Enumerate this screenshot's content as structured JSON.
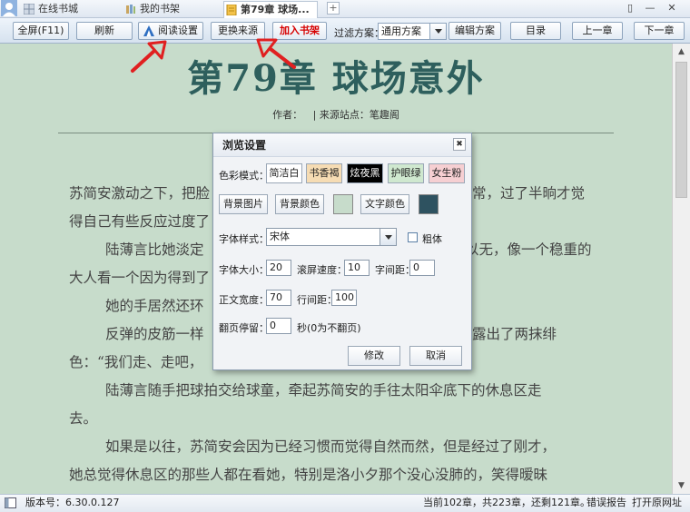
{
  "tabs": [
    {
      "label": "在线书城"
    },
    {
      "label": "我的书架"
    },
    {
      "label": "第79章 球场..."
    }
  ],
  "new_tab": "+",
  "window_controls": {
    "restore": "▯",
    "minimize": "—",
    "close": "✕"
  },
  "toolbar": {
    "fullscreen": "全屏(F11)",
    "refresh": "刷新",
    "read_settings": "阅读设置",
    "change_source": "更换来源",
    "add_shelf": "加入书架",
    "filter_label": "过滤方案：",
    "filter_value": "通用方案",
    "edit_filter": "编辑方案",
    "catalog": "目录",
    "prev": "上一章",
    "next": "下一章"
  },
  "chapter": {
    "title": "第79章  球场意外",
    "author_label": "作者：",
    "source_label": "| 来源站点：笔趣阁",
    "paragraphs": [
      "苏简安激动之下，把脸",
      "得自己有些反应过度了",
      "陆薄言比她淡定",
      "大人看一个因为得到了",
      "她的手居然还环",
      "反弹的皮筋一样",
      "色：“我们走、走吧，",
      "陆薄言随手把球拍交给球童，牵起苏简安的手往太阳伞底下的休息区走",
      "去。",
      "如果是以往，苏简安会因为已经习惯而觉得自然而然，但是经过了刚才，",
      "她总觉得休息区的那些人都在看她，特别是洛小夕那个没心没肺的，笑得暧昧"
    ],
    "right_fragments": [
      "常，过了半晌才觉",
      "以无，像一个稳重的",
      "露出了两抹绯"
    ]
  },
  "dialog": {
    "title": "浏览设置",
    "close": "✖",
    "color_mode_label": "色彩模式：",
    "swatches": [
      {
        "label": "简洁白",
        "bg": "#ffffff",
        "fg": "#222222"
      },
      {
        "label": "书香褐",
        "bg": "#f6dcb3",
        "fg": "#222222"
      },
      {
        "label": "炫夜黑",
        "bg": "#000000",
        "fg": "#ffffff"
      },
      {
        "label": "护眼绿",
        "bg": "#cfe8cf",
        "fg": "#222222"
      },
      {
        "label": "女生粉",
        "bg": "#f6cfd2",
        "fg": "#222222"
      }
    ],
    "bg_image": "背景图片",
    "bg_color": "背景颜色",
    "bg_color_value": "#c7dccb",
    "text_color": "文字颜色",
    "text_color_value": "#2e5260",
    "font_style_label": "字体样式：",
    "font_value": "宋体",
    "bold_label": "粗体",
    "font_size_label": "字体大小：",
    "font_size": "20",
    "scroll_speed_label": "滚屏速度：",
    "scroll_speed": "10",
    "letter_spacing_label": "字间距：",
    "letter_spacing": "0",
    "width_label": "正文宽度：",
    "width": "70",
    "line_spacing_label": "行间距：",
    "line_spacing": "100",
    "page_stay_label": "翻页停留：",
    "page_stay": "0",
    "page_stay_unit": "秒(0为不翻页)",
    "ok": "修改",
    "cancel": "取消"
  },
  "status": {
    "version": "版本号：6.30.0.127",
    "progress": "当前102章，共223章，还剩121章。",
    "report": "错误报告",
    "open_url": "打开原网址"
  },
  "colors": {
    "reader_bg": "#c7dccb",
    "title": "#2e5f5d",
    "arrow": "#e02020"
  }
}
